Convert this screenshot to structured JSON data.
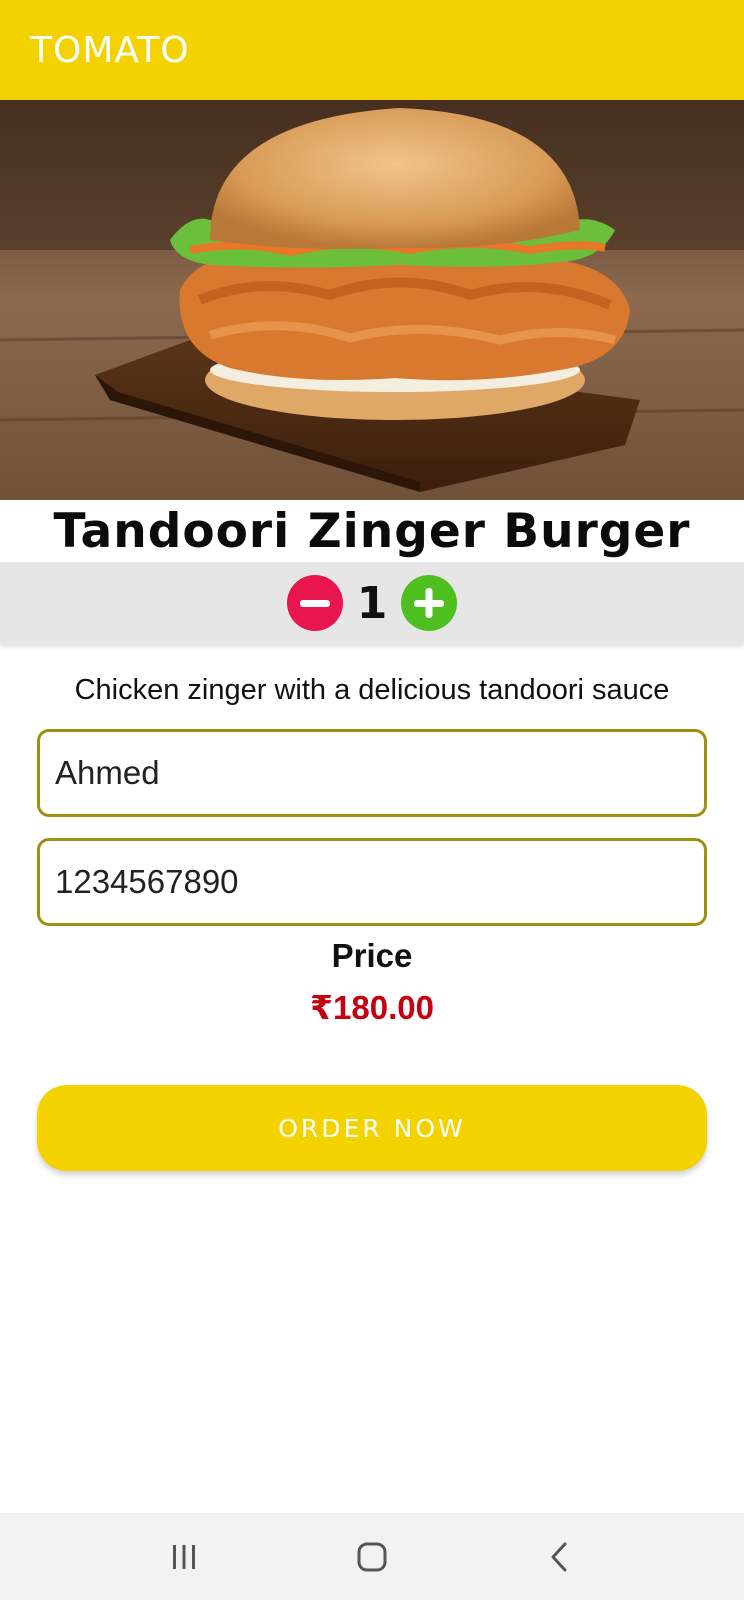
{
  "app_bar": {
    "title": "TOMATO"
  },
  "product": {
    "image_alt": "burger-photo",
    "title": "Tandoori Zinger Burger",
    "description": "Chicken zinger with a delicious tandoori sauce"
  },
  "quantity": {
    "value": "1"
  },
  "form": {
    "name_value": "Ahmed",
    "phone_value": "1234567890"
  },
  "price": {
    "label": "Price",
    "value": "₹180.00"
  },
  "order_button": {
    "label": "ORDER NOW"
  },
  "icons": {
    "minus": "minus-circle-icon",
    "plus": "plus-circle-icon",
    "recents": "recents-icon",
    "home": "home-icon",
    "back": "back-icon"
  },
  "colors": {
    "accent": "#f4d200",
    "price": "#c5000f",
    "minus": "#e8164c",
    "plus": "#4fbf1f",
    "field_border": "#9e9010"
  }
}
